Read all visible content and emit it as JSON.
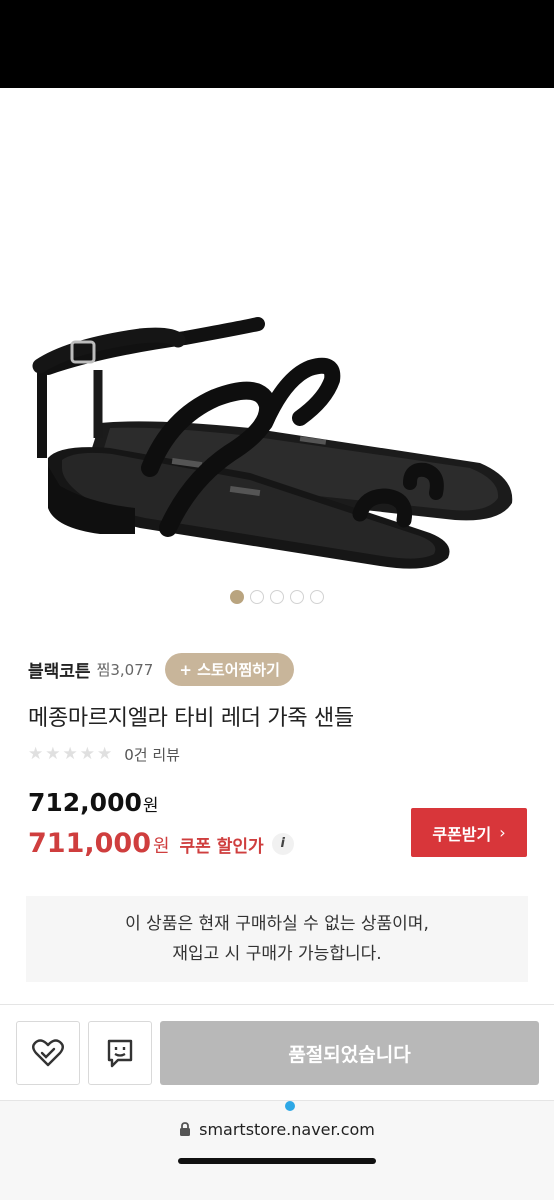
{
  "product": {
    "store_name": "블랙코튼",
    "zzim": "찜3,077",
    "follow_label": "+ 스토어찜하기",
    "title": "메종마르지엘라 타비 레더 가죽 샌들",
    "review_text": "0건 리뷰",
    "rating_stars": 0,
    "price": "712,000",
    "price_unit": "원",
    "sale_price": "711,000",
    "sale_unit": "원",
    "sale_label": "쿠폰 할인가",
    "info_glyph": "i",
    "image_dots": {
      "count": 5,
      "active": 0
    }
  },
  "coupon": {
    "label": "쿠폰받기",
    "chevron": "›"
  },
  "notice": {
    "line1": "이 상품은 현재 구매하실 수 없는 상품이며,",
    "line2": "재입고 시 구매가 가능합니다."
  },
  "actions": {
    "wish_icon": "heart-check-icon",
    "talk_icon": "talk-icon",
    "soldout_label": "품절되었습니다"
  },
  "browser": {
    "url": "smartstore.naver.com",
    "lock_icon": "lock-icon"
  },
  "colors": {
    "accent_red": "#d8363a",
    "sale_red": "#cf3e3e",
    "follow_beige": "#c8b59a",
    "soldout_gray": "#b8b8b8"
  }
}
